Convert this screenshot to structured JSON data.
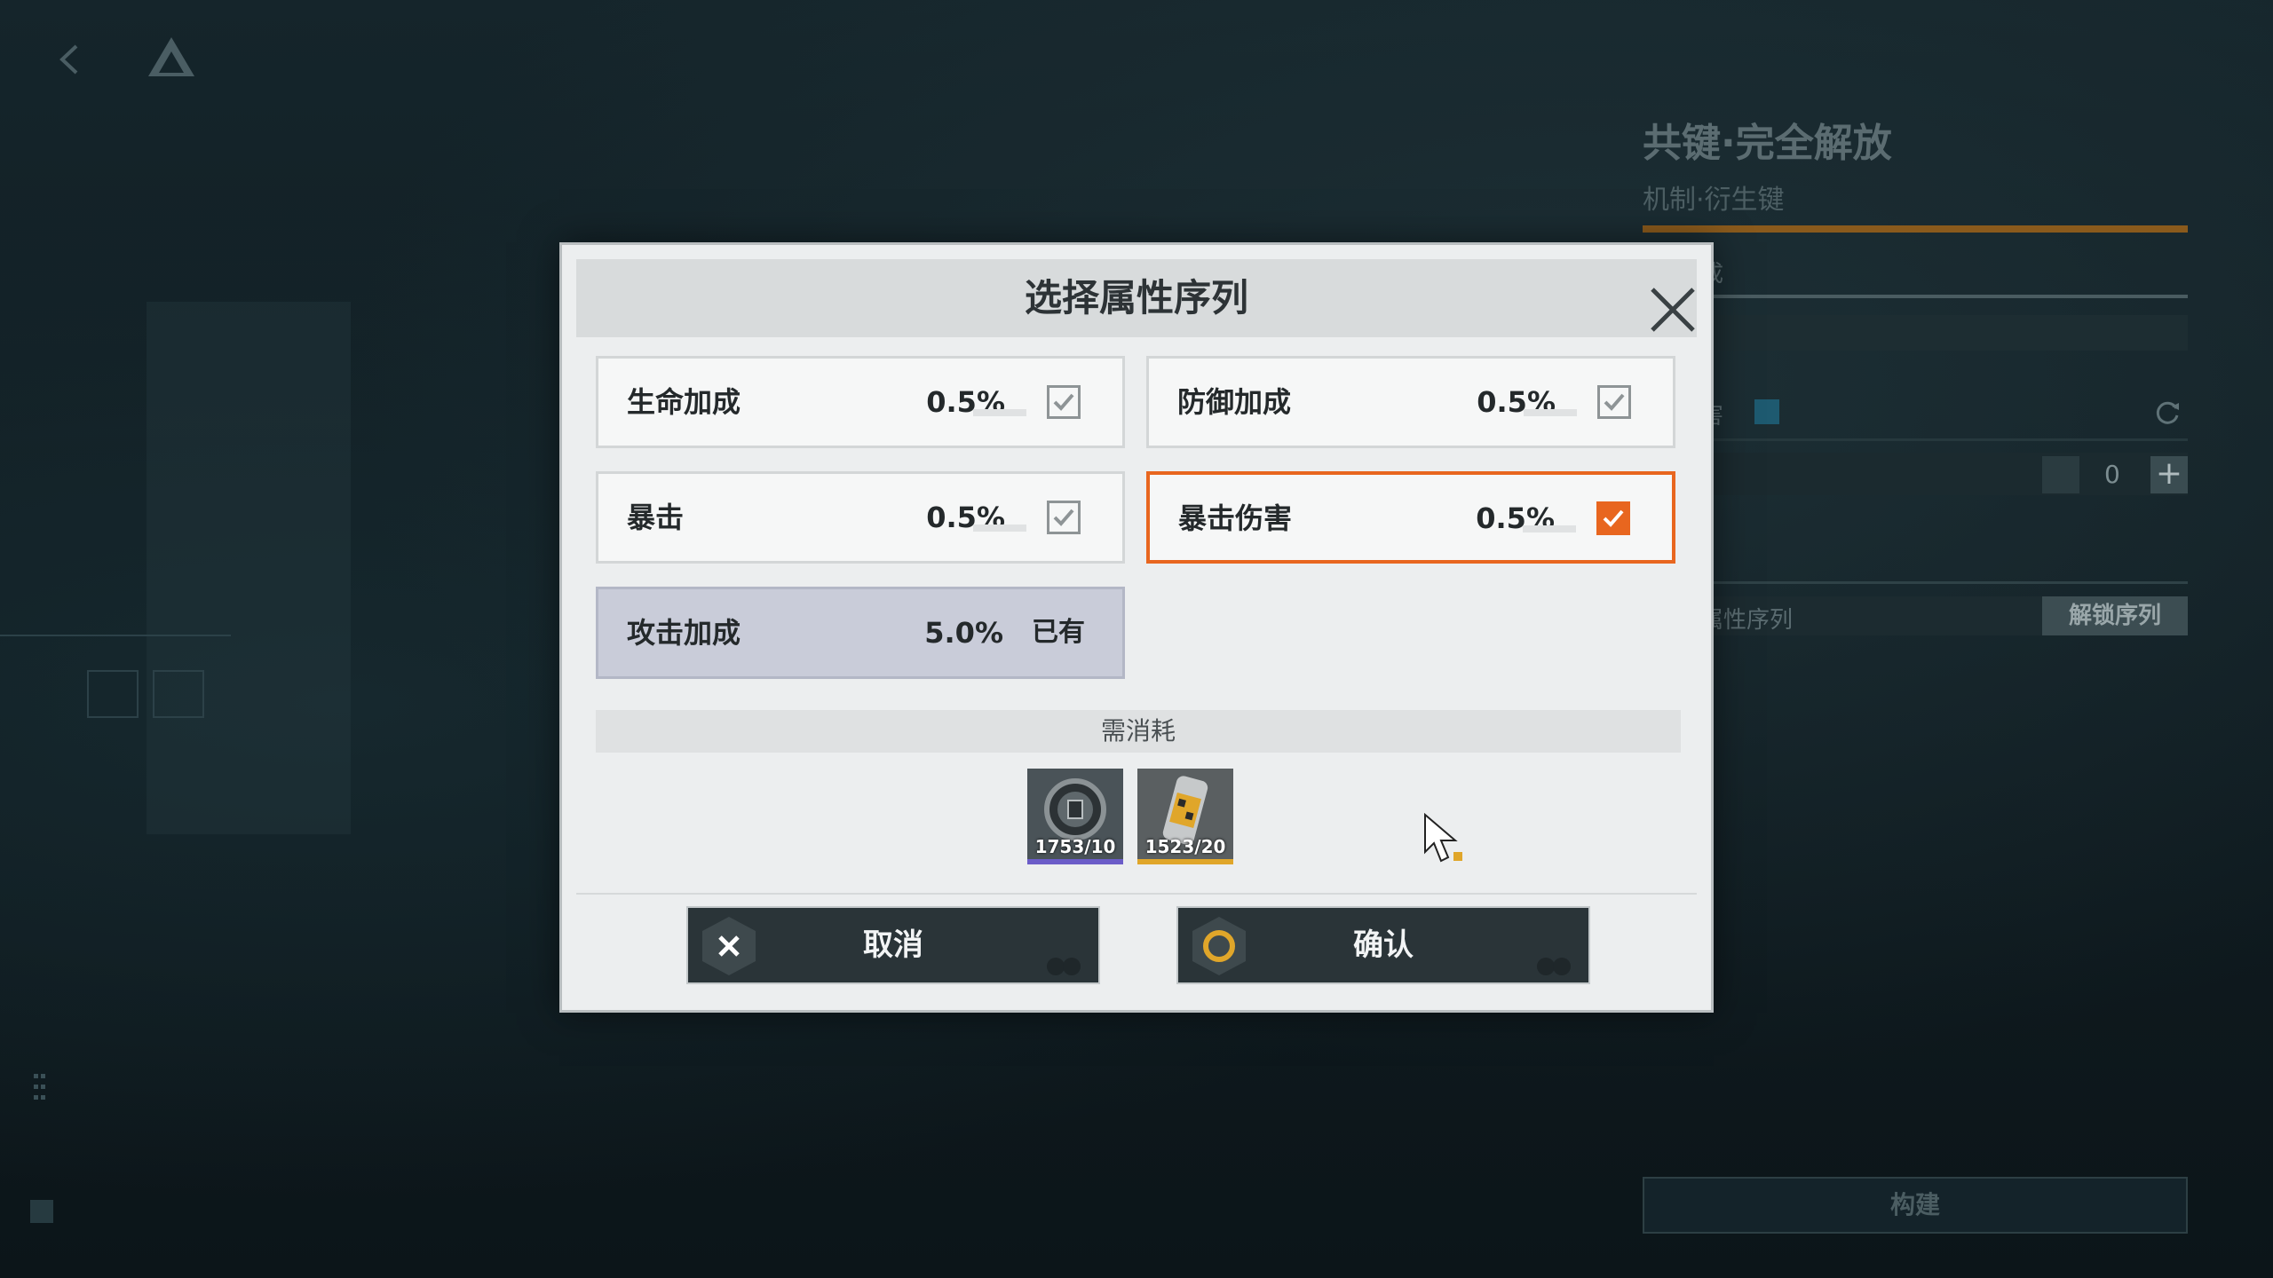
{
  "background": {
    "right_panel": {
      "title": "共键·完全解放",
      "subtitle": "机制·衍生键",
      "tab_partial": "成",
      "label_partial": "害",
      "stepper_value": "0",
      "seq_label_partial": "属性序列",
      "unlock_button": "解锁序列",
      "build_button": "构建"
    }
  },
  "modal": {
    "title": "选择属性序列",
    "options": [
      {
        "name": "生命加成",
        "value": "0.5%",
        "checked": true,
        "selected": false
      },
      {
        "name": "防御加成",
        "value": "0.5%",
        "checked": true,
        "selected": false
      },
      {
        "name": "暴击",
        "value": "0.5%",
        "checked": true,
        "selected": false
      },
      {
        "name": "暴击伤害",
        "value": "0.5%",
        "checked": true,
        "selected": true
      },
      {
        "name": "攻击加成",
        "value": "5.0%",
        "owned_label": "已有"
      }
    ],
    "cost_label": "需消耗",
    "items": [
      {
        "icon": "coin-token-icon",
        "qty": "1753/10",
        "rarity_color": "#6b5cc8"
      },
      {
        "icon": "fuel-canister-icon",
        "qty": "1523/20",
        "rarity_color": "#e0a62a"
      }
    ],
    "cancel_label": "取消",
    "confirm_label": "确认",
    "accent_color": "#e8661f"
  }
}
